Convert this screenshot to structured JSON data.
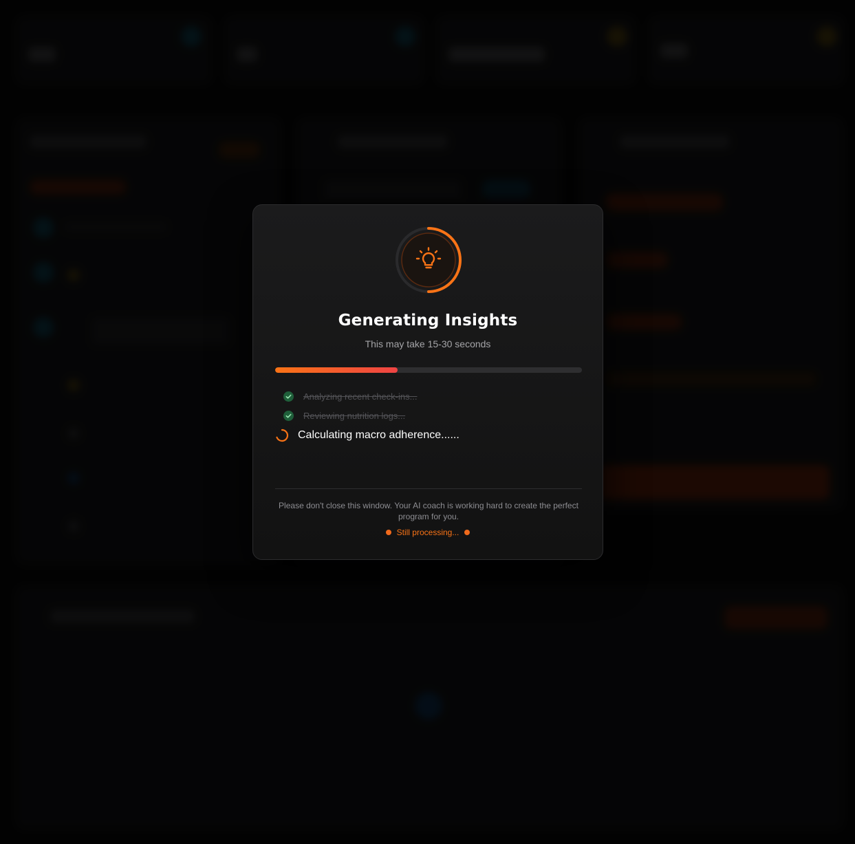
{
  "modal": {
    "title": "Generating Insights",
    "subtitle": "This may take 15-30 seconds",
    "progress": 0.4,
    "steps": [
      {
        "label": "Analyzing recent check-ins...",
        "status": "done"
      },
      {
        "label": "Reviewing nutrition logs...",
        "status": "done"
      },
      {
        "label": "Calculating macro adherence......",
        "status": "in-progress"
      }
    ],
    "footer_note": "Please don't close this window. Your AI coach is working hard to create the perfect program for you.",
    "processing_label": "Still processing...",
    "icon": "lightbulb-icon"
  },
  "colors": {
    "accent": "#f97316",
    "accent_end": "#ef4444",
    "success": "#22c55e",
    "modal_bg": "#161616",
    "page_bg": "#050505"
  }
}
